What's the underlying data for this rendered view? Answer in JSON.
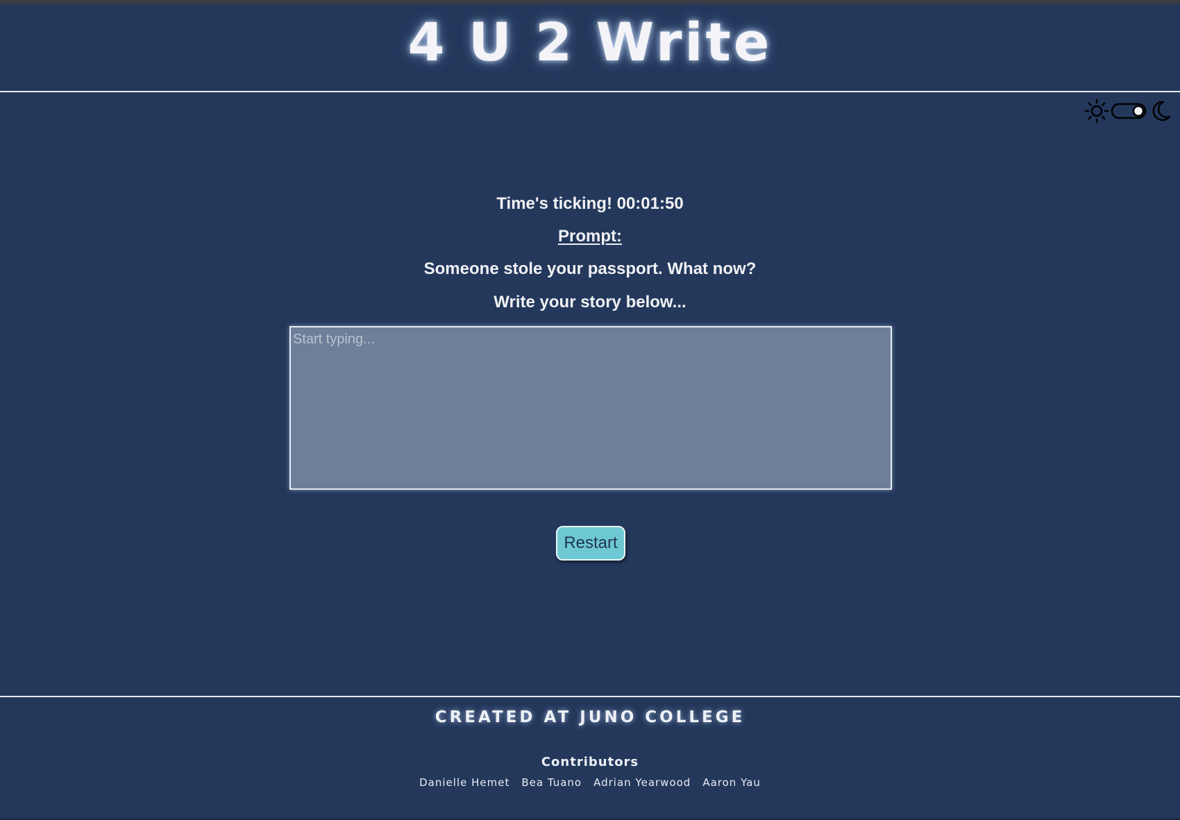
{
  "header": {
    "title": "4 U 2 Write"
  },
  "theme_toggle": {
    "light_icon": "sun-icon",
    "dark_icon": "moon-icon",
    "mode": "dark"
  },
  "main": {
    "timer_text": "Time's ticking! 00:01:50",
    "prompt_label": "Prompt:",
    "prompt_text": "Someone stole your passport. What now?",
    "write_label": "Write your story below...",
    "story_input": {
      "placeholder": "Start typing...",
      "value": ""
    },
    "restart_label": "Restart"
  },
  "footer": {
    "title": "CREATED AT JUNO COLLEGE",
    "contributors_heading": "Contributors",
    "contributors": [
      "Danielle Hemet",
      "Bea Tuano",
      "Adrian Yearwood",
      "Aaron Yau"
    ]
  },
  "colors": {
    "background": "#23385b",
    "text": "#f1f1f4",
    "textarea_bg": "#6e7f99",
    "button_bg": "#6ec8d3",
    "button_text": "#1f3554"
  }
}
